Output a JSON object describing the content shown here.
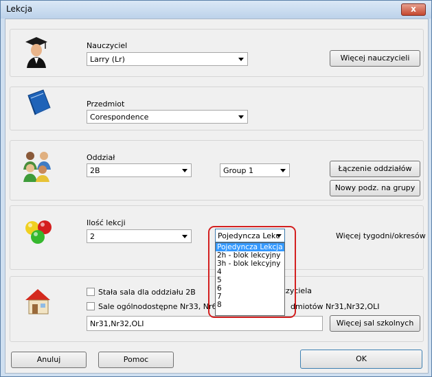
{
  "window": {
    "title": "Lekcja",
    "close_label": "x"
  },
  "teacher": {
    "label": "Nauczyciel",
    "value": "Larry (Lr)",
    "more_button": "Więcej nauczycieli"
  },
  "subject": {
    "label": "Przedmiot",
    "value": "Corespondence"
  },
  "class": {
    "label": "Oddział",
    "value": "2B",
    "group_value": "Group 1",
    "join_button": "Łączenie oddziałów",
    "split_button": "Nowy podz. na grupy"
  },
  "lessons": {
    "label": "Ilość lekcji",
    "value": "2",
    "type_value": "Pojedyncza Lekc",
    "type_options": [
      "Pojedyncza Lekcja",
      "2h - blok lekcyjny",
      "3h - blok lekcyjny",
      "4",
      "5",
      "6",
      "7",
      "8"
    ],
    "weeks_label": "Więcej tygodni/okresów"
  },
  "rooms": {
    "fixed_room_label": "Stała sala dla oddziału 2B",
    "fixed_room_suffix": "czyciela",
    "public_rooms_label": "Sale ogólnodostępne Nr33, Nr62, Nr",
    "public_rooms_suffix": "dmiotów Nr31,Nr32,OLI",
    "rooms_value": "Nr31,Nr32,OLI",
    "more_rooms_button": "Więcej sal szkolnych"
  },
  "footer": {
    "cancel": "Anuluj",
    "help": "Pomoc",
    "ok": "OK"
  }
}
